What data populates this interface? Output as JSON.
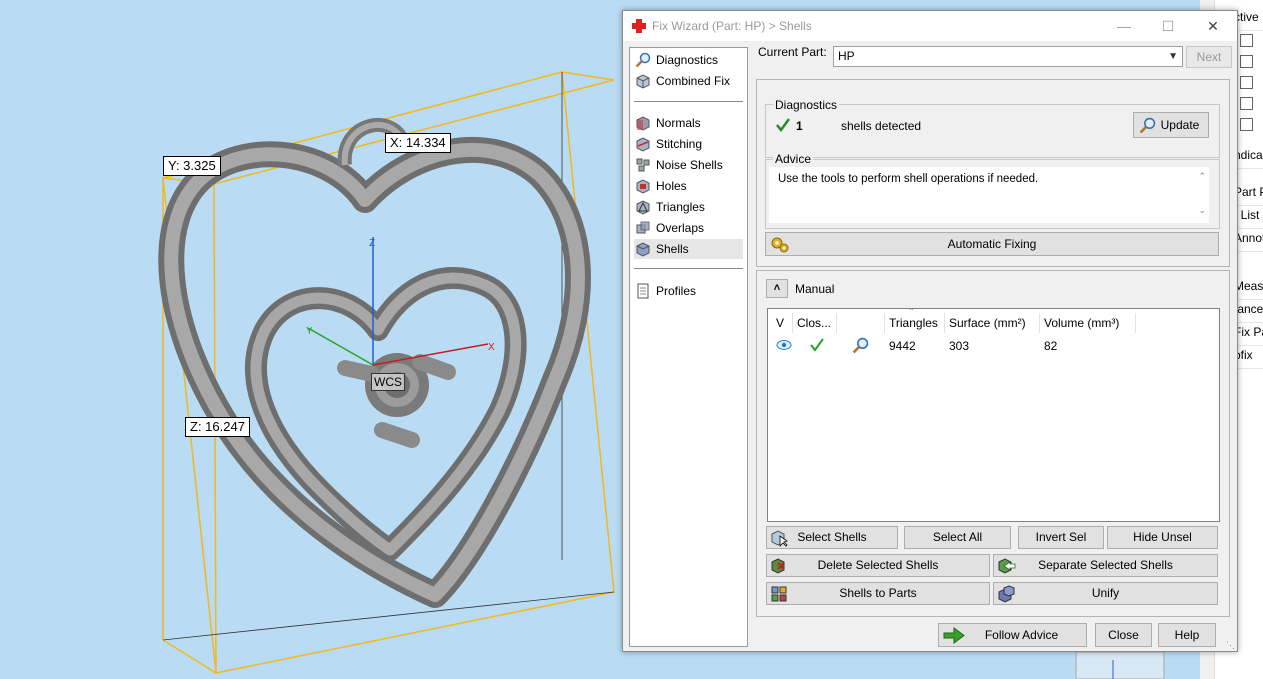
{
  "viewport": {
    "dims": {
      "y": "Y: 3.325",
      "x": "X: 14.334",
      "z": "Z: 16.247"
    },
    "axis_labels": {
      "z": "Z",
      "x": "X",
      "y": "Y"
    },
    "wcs": "WCS",
    "colors": {
      "background": "#b9dcf4",
      "bbox": "#f2b81c",
      "model": "#8a8a8a"
    }
  },
  "right_panel": {
    "rows": [
      "ctive",
      "",
      "",
      "",
      "",
      "ndica",
      "Part P",
      "t List",
      "Annot",
      "",
      "Measu",
      "tance",
      "Fix Pa",
      "ofix"
    ]
  },
  "dialog": {
    "title": "Fix Wizard (Part: HP) > Shells",
    "window_controls": {
      "minimize": "—",
      "maximize": "☐",
      "close": "✕"
    },
    "nav": {
      "top": [
        {
          "label": "Diagnostics",
          "icon": "magnifier-icon"
        },
        {
          "label": "Combined Fix",
          "icon": "cube-icon"
        }
      ],
      "tools": [
        {
          "label": "Normals",
          "icon": "normals-icon"
        },
        {
          "label": "Stitching",
          "icon": "stitching-icon"
        },
        {
          "label": "Noise Shells",
          "icon": "noise-shells-icon"
        },
        {
          "label": "Holes",
          "icon": "holes-icon"
        },
        {
          "label": "Triangles",
          "icon": "triangles-icon"
        },
        {
          "label": "Overlaps",
          "icon": "overlaps-icon"
        },
        {
          "label": "Shells",
          "icon": "shells-icon",
          "selected": true
        }
      ],
      "bottom": [
        {
          "label": "Profiles",
          "icon": "document-icon"
        }
      ]
    },
    "current_part": {
      "label": "Current Part:",
      "value": "HP"
    },
    "next_button": "Next",
    "diagnostics": {
      "title": "Diagnostics",
      "count": "1",
      "text": "shells detected",
      "update_button": "Update"
    },
    "advice": {
      "title": "Advice",
      "text": "Use the tools to perform shell operations if needed."
    },
    "automatic_fixing": "Automatic Fixing",
    "manual": {
      "title": "Manual",
      "columns": [
        "V",
        "Clos...",
        "",
        "Triangles",
        "Surface (mm²)",
        "Volume (mm³)"
      ],
      "rows": [
        {
          "visible_icon": "eye-icon",
          "closed_icon": "checkmark-icon",
          "zoom_icon": "magnifier-icon",
          "triangles": "9442",
          "surface": "303",
          "volume": "82"
        }
      ],
      "buttons": {
        "select_shells": "Select Shells",
        "select_all": "Select All",
        "invert_sel": "Invert Sel",
        "hide_unsel": "Hide Unsel",
        "delete_selected": "Delete Selected Shells",
        "separate_selected": "Separate Selected Shells",
        "shells_to_parts": "Shells to Parts",
        "unify": "Unify"
      }
    },
    "footer": {
      "follow_advice": "Follow Advice",
      "close": "Close",
      "help": "Help"
    }
  }
}
